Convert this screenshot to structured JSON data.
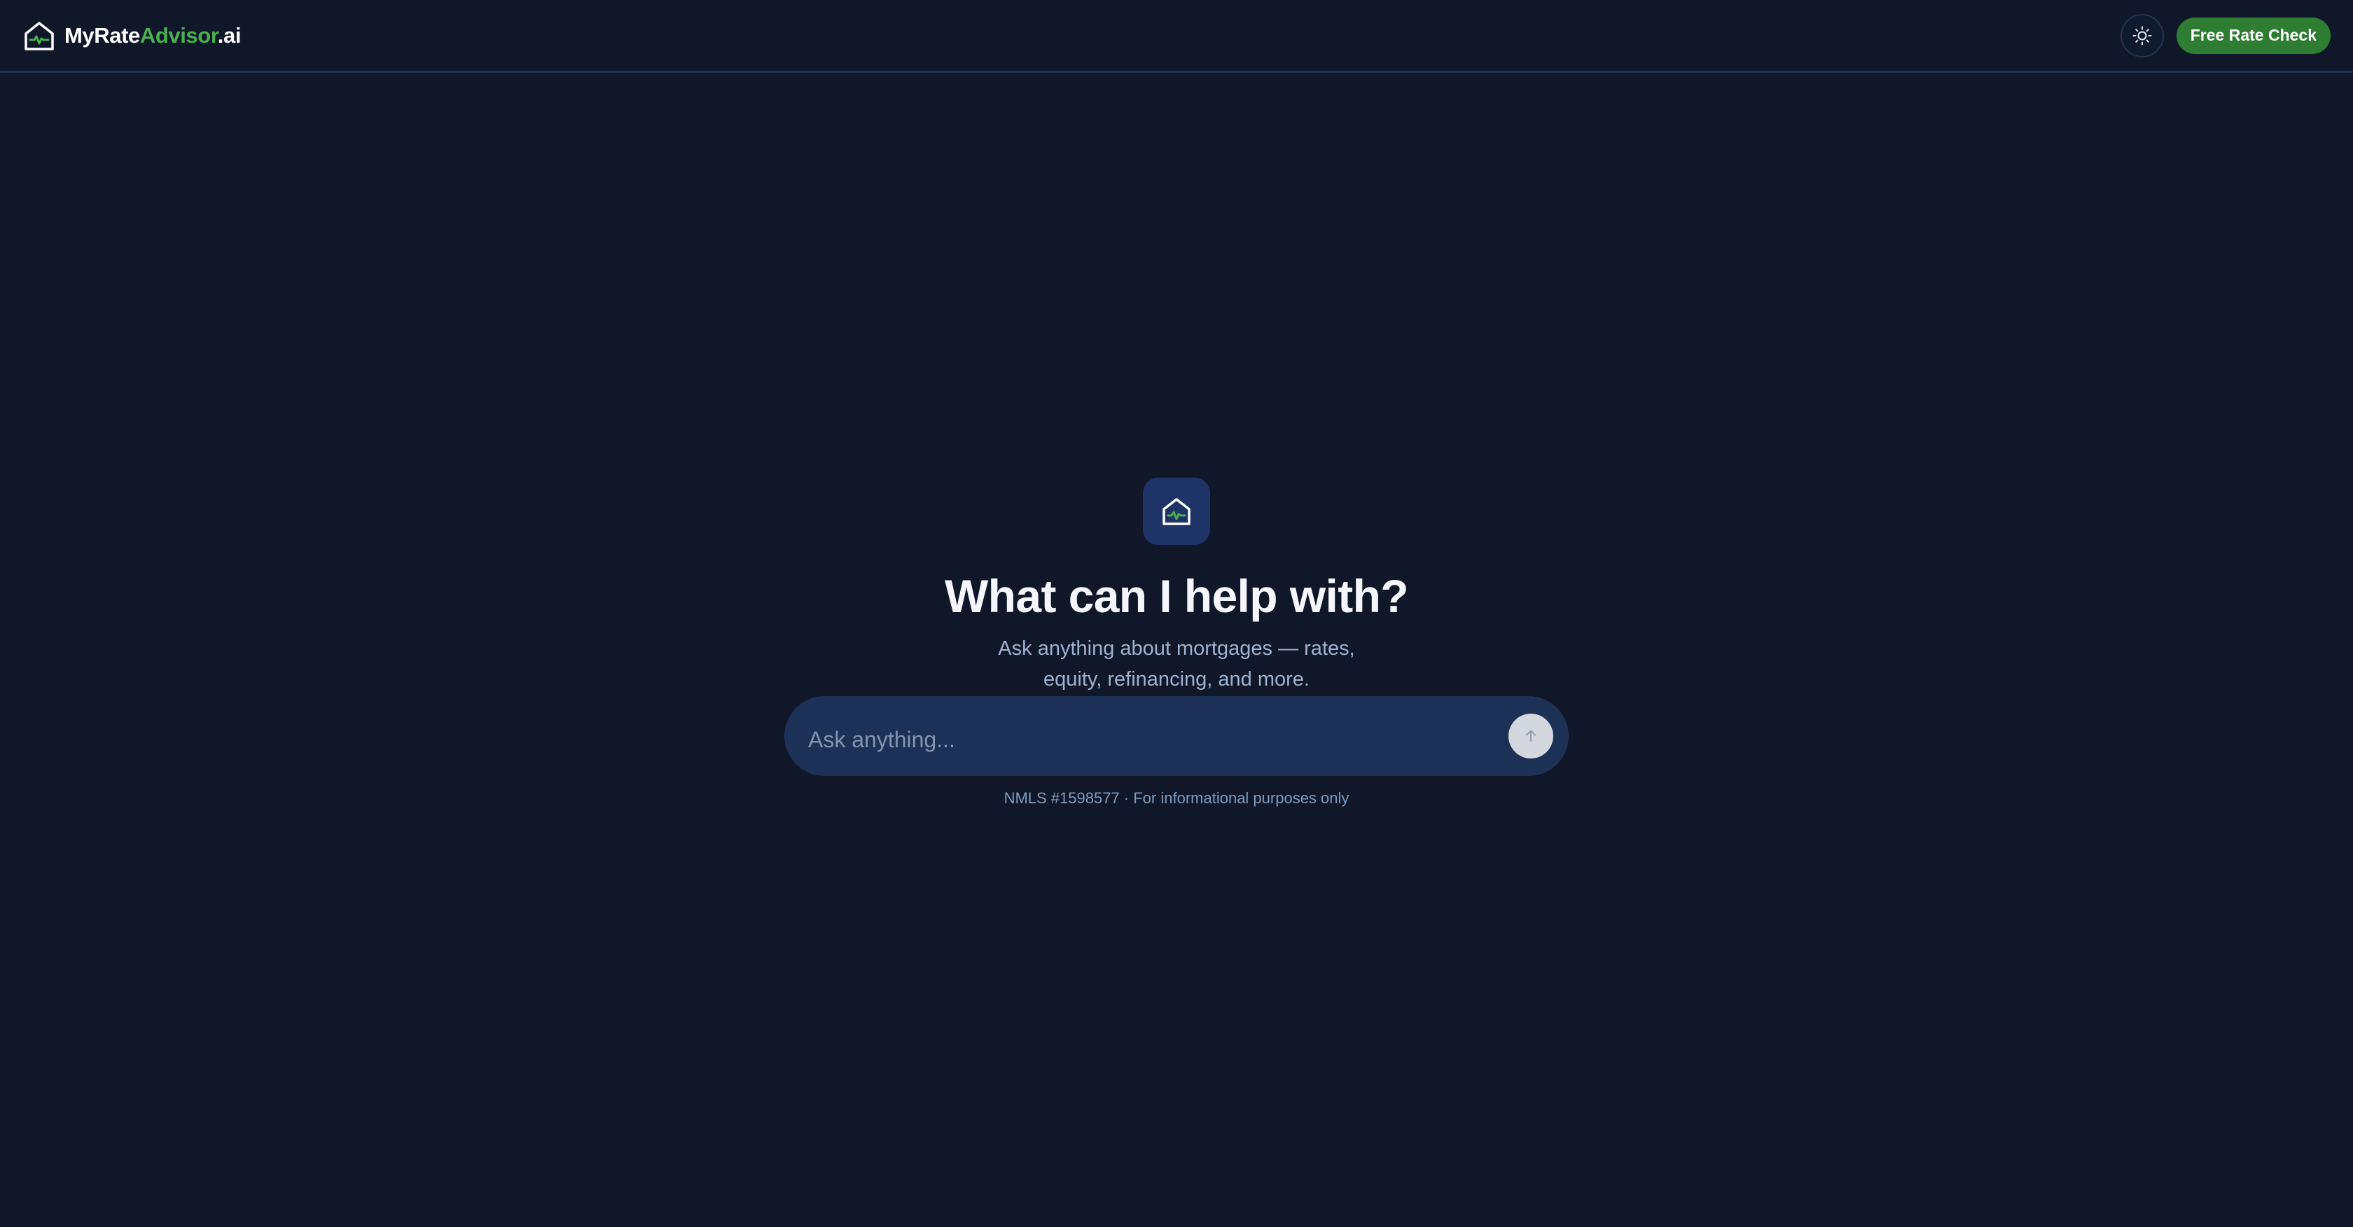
{
  "header": {
    "brand": {
      "part1": "MyRate",
      "part2": "Advisor",
      "part3": ".ai",
      "logo_icon": "house-pulse-icon"
    },
    "theme_toggle_icon": "sun-icon",
    "cta_label": "Free Rate Check"
  },
  "hero": {
    "icon": "house-pulse-icon",
    "title": "What can I help with?",
    "subtitle": "Ask anything about mortgages — rates, equity, refinancing, and more."
  },
  "chat": {
    "placeholder": "Ask anything...",
    "value": "",
    "send_icon": "arrow-up-icon"
  },
  "footer": {
    "disclaimer": "NMLS #1598577 · For informational purposes only"
  },
  "colors": {
    "background": "#0f1729",
    "brand_accent": "#4caf50",
    "cta": "#2e7d32",
    "chat_box": "#1d3156",
    "hero_icon_bg": "#1e3366"
  }
}
